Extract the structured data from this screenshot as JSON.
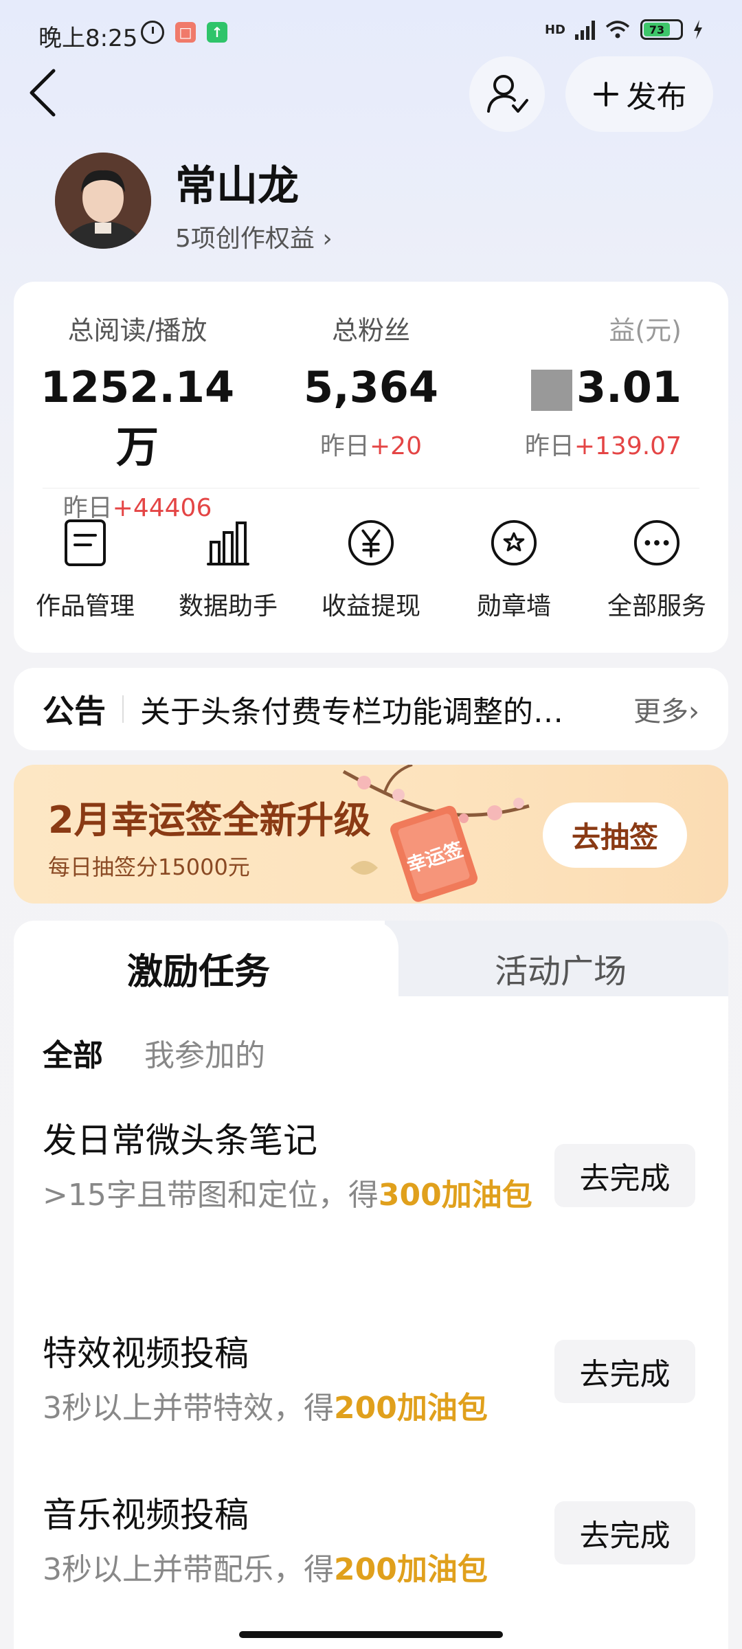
{
  "status_bar": {
    "time": "晚上8:25",
    "network": "HD",
    "battery": "73"
  },
  "header": {
    "publish_label": "发布"
  },
  "profile": {
    "name": "常山龙",
    "rights": "5项创作权益 ›"
  },
  "stats": {
    "reads": {
      "label": "总阅读/播放",
      "value": "1252.14万",
      "sub_prefix": "昨日",
      "sub_change": "+44406"
    },
    "fans": {
      "label": "总粉丝",
      "value": "5,364",
      "sub_prefix": "昨日",
      "sub_change": "+20"
    },
    "income": {
      "label": "益(元)",
      "value": "3.01",
      "sub_prefix": "昨日",
      "sub_change": "+139.07"
    }
  },
  "tools": [
    {
      "label": "作品管理",
      "icon": "document-icon"
    },
    {
      "label": "数据助手",
      "icon": "bar-chart-icon"
    },
    {
      "label": "收益提现",
      "icon": "yen-icon"
    },
    {
      "label": "勋章墙",
      "icon": "medal-icon"
    },
    {
      "label": "全部服务",
      "icon": "more-icon"
    }
  ],
  "notice": {
    "title": "公告",
    "text": "关于头条付费专栏功能调整的…",
    "more": "更多›"
  },
  "banner": {
    "title": "2月幸运签全新升级",
    "subtitle": "每日抽签分15000元",
    "button": "去抽签",
    "decoration_text": "幸运签"
  },
  "tabs": {
    "active": "激励任务",
    "other": "活动广场"
  },
  "filters": {
    "all": "全部",
    "mine": "我参加的"
  },
  "tasks": [
    {
      "title": "发日常微头条笔记",
      "desc_prefix": ">15字且带图和定位，得",
      "reward": "300加油包",
      "button": "去完成"
    },
    {
      "title": "特效视频投稿",
      "desc_prefix": "3秒以上并带特效，得",
      "reward": "200加油包",
      "button": "去完成"
    },
    {
      "title": "音乐视频投稿",
      "desc_prefix": "3秒以上并带配乐，得",
      "reward": "200加油包",
      "button": "去完成"
    }
  ],
  "colors": {
    "increase": "#e44545",
    "reward": "#e0a01c",
    "banner_text": "#8a3a14"
  }
}
